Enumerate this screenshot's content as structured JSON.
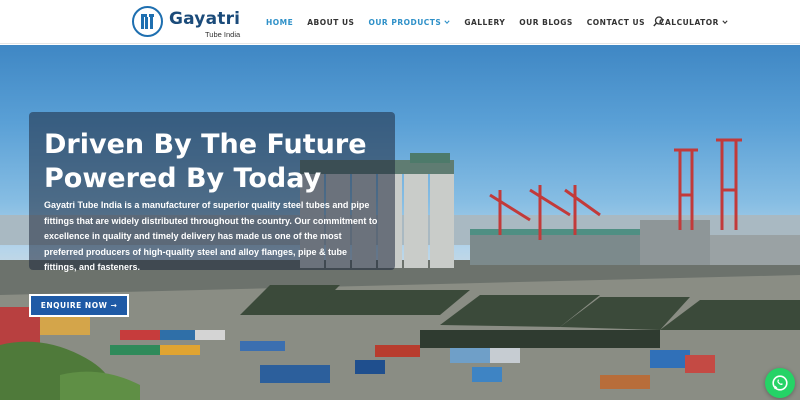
{
  "brand": {
    "name": "Gayatri",
    "tagline": "Tube India",
    "logo_icon": "gt-circle-logo-icon",
    "primary_color": "#1e6fb0"
  },
  "nav": {
    "items": [
      {
        "label": "HOME",
        "active": true
      },
      {
        "label": "ABOUT US",
        "active": false
      },
      {
        "label": "OUR PRODUCTS",
        "active": false,
        "dropdown": true
      },
      {
        "label": "GALLERY",
        "active": false
      },
      {
        "label": "OUR BLOGS",
        "active": false
      },
      {
        "label": "CONTACT US",
        "active": false
      },
      {
        "label": "CALCULATOR",
        "active": false,
        "dropdown": true
      }
    ],
    "active_color": "#2e90c8",
    "search_icon": "search-icon"
  },
  "hero": {
    "title": "Driven By The Future Powered By Today",
    "brand_bold": "Gayatri Tube India",
    "body": " is a manufacturer of superior quality steel tubes and pipe fittings that are widely distributed throughout the country. Our commitment to excellence in quality and timely delivery has made us one of the most preferred producers of high-quality steel and alloy flanges, pipe & tube fittings, and fasteners.",
    "cta_label": "ENQUIRE NOW →",
    "background": "industrial-port-yard-photo"
  },
  "floating": {
    "whatsapp_icon": "whatsapp-icon",
    "whatsapp_color": "#25d366"
  }
}
